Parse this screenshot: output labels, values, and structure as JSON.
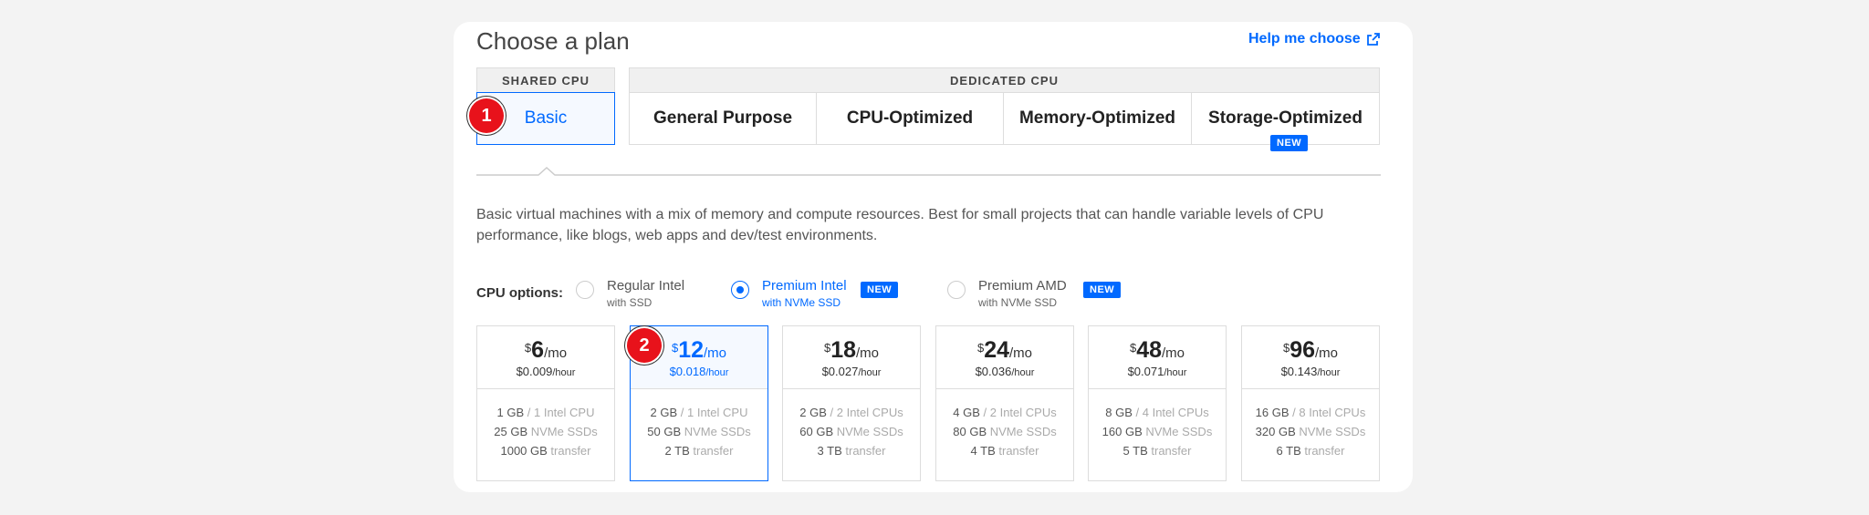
{
  "header": {
    "title": "Choose a plan",
    "help_label": "Help me choose"
  },
  "groups": {
    "shared": "SHARED CPU",
    "dedicated": "DEDICATED CPU"
  },
  "tabs": [
    {
      "label": "Basic",
      "active": true
    },
    {
      "label": "General Purpose"
    },
    {
      "label": "CPU-Optimized"
    },
    {
      "label": "Memory-Optimized"
    },
    {
      "label": "Storage-Optimized",
      "badge": "NEW"
    }
  ],
  "markers": [
    "1",
    "2"
  ],
  "description": "Basic virtual machines with a mix of memory and compute resources. Best for small projects that can handle variable levels of CPU performance, like blogs, web apps and dev/test environments.",
  "cpu_options": {
    "label": "CPU options:",
    "options": [
      {
        "main": "Regular Intel",
        "sub": "with SSD"
      },
      {
        "main": "Premium Intel",
        "sub": "with NVMe SSD",
        "badge": "NEW",
        "selected": true
      },
      {
        "main": "Premium AMD",
        "sub": "with NVMe SSD",
        "badge": "NEW"
      }
    ]
  },
  "plans": [
    {
      "currency": "$",
      "amount": "6",
      "per": "/mo",
      "hourly": "$0.009",
      "hourly_unit": "/hour",
      "mem": "1 GB",
      "cpu": " / 1 Intel CPU",
      "disk": "25 GB",
      "disk_type": " NVMe SSDs",
      "transfer": "1000 GB",
      "transfer_label": " transfer"
    },
    {
      "currency": "$",
      "amount": "12",
      "per": "/mo",
      "hourly": "$0.018",
      "hourly_unit": "/hour",
      "mem": "2 GB",
      "cpu": " / 1 Intel CPU",
      "disk": "50 GB",
      "disk_type": " NVMe SSDs",
      "transfer": "2 TB",
      "transfer_label": " transfer"
    },
    {
      "currency": "$",
      "amount": "18",
      "per": "/mo",
      "hourly": "$0.027",
      "hourly_unit": "/hour",
      "mem": "2 GB",
      "cpu": " / 2 Intel CPUs",
      "disk": "60 GB",
      "disk_type": " NVMe SSDs",
      "transfer": "3 TB",
      "transfer_label": " transfer"
    },
    {
      "currency": "$",
      "amount": "24",
      "per": "/mo",
      "hourly": "$0.036",
      "hourly_unit": "/hour",
      "mem": "4 GB",
      "cpu": " / 2 Intel CPUs",
      "disk": "80 GB",
      "disk_type": " NVMe SSDs",
      "transfer": "4 TB",
      "transfer_label": " transfer"
    },
    {
      "currency": "$",
      "amount": "48",
      "per": "/mo",
      "hourly": "$0.071",
      "hourly_unit": "/hour",
      "mem": "8 GB",
      "cpu": " / 4 Intel CPUs",
      "disk": "160 GB",
      "disk_type": " NVMe SSDs",
      "transfer": "5 TB",
      "transfer_label": " transfer"
    },
    {
      "currency": "$",
      "amount": "96",
      "per": "/mo",
      "hourly": "$0.143",
      "hourly_unit": "/hour",
      "mem": "16 GB",
      "cpu": " / 8 Intel CPUs",
      "disk": "320 GB",
      "disk_type": " NVMe SSDs",
      "transfer": "6 TB",
      "transfer_label": " transfer"
    }
  ],
  "colors": {
    "accent": "#0069ff",
    "marker": "#e8121b"
  }
}
